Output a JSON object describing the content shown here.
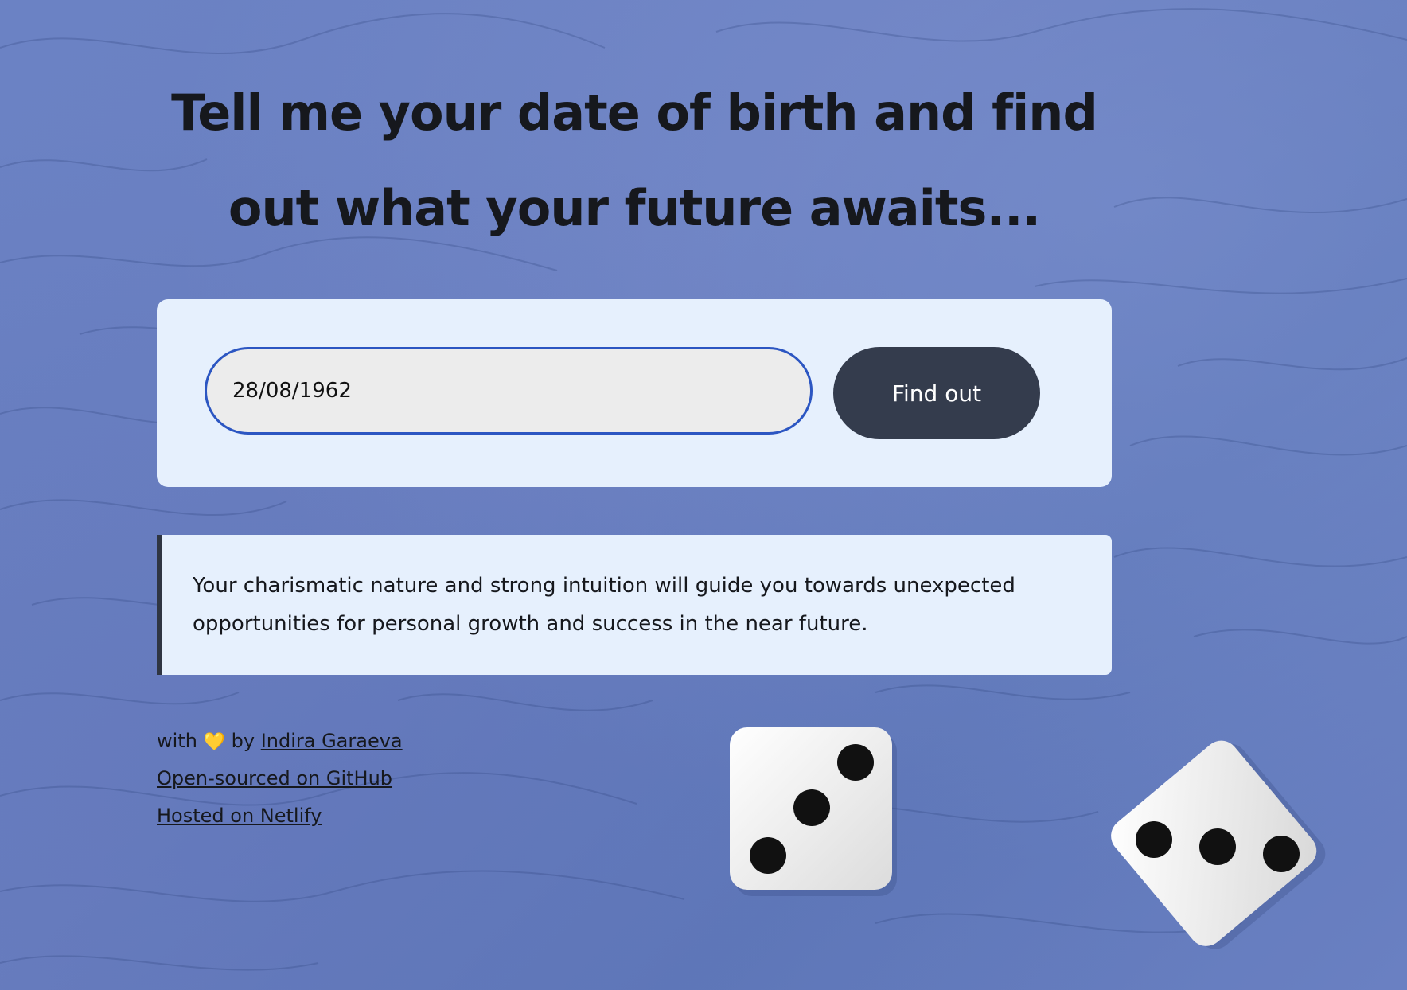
{
  "header": {
    "title": "Tell me your date of birth and find out what your future awaits..."
  },
  "form": {
    "date_value": "28/08/1962",
    "submit_label": "Find out"
  },
  "result": {
    "text": "Your charismatic nature and strong intuition will guide you towards unexpected opportunities for personal growth and success in the near future."
  },
  "footer": {
    "credit_prefix": "with",
    "heart": "💛",
    "credit_by": "by",
    "author_link": "Indira Garaeva",
    "github_link": "Open-sourced on GitHub",
    "netlify_link": "Hosted on Netlify"
  },
  "icons": {
    "heart": "yellow-heart-icon",
    "die_left": "die-three-icon",
    "die_right": "die-three-icon"
  },
  "colors": {
    "background": "#6a80c2",
    "card": "#e6f0fd",
    "input_border": "#2c56c2",
    "button": "#343c4d",
    "result_accent": "#2f3542"
  }
}
